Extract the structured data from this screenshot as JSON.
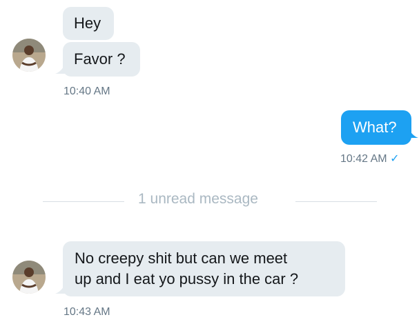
{
  "conversation": {
    "messages": [
      {
        "direction": "incoming",
        "text": "Hey"
      },
      {
        "direction": "incoming",
        "text": "Favor ?"
      },
      {
        "direction": "outgoing",
        "text": "What?"
      },
      {
        "direction": "incoming",
        "text": "No creepy shit but can we meet"
      },
      {
        "direction": "incoming",
        "text": "up and I eat yo pussy in the car ?"
      }
    ],
    "timestamps": {
      "first": "10:40 AM",
      "second": "10:42 AM",
      "third": "10:43 AM"
    },
    "read_receipt_icon": "checkmark-icon",
    "read_receipt_glyph": "✓",
    "unread_divider": "1 unread message"
  },
  "colors": {
    "incoming_bubble": "#e6ecf0",
    "outgoing_bubble": "#1da1f2",
    "timestamp": "#657786",
    "divider_text": "#aab8c2"
  }
}
